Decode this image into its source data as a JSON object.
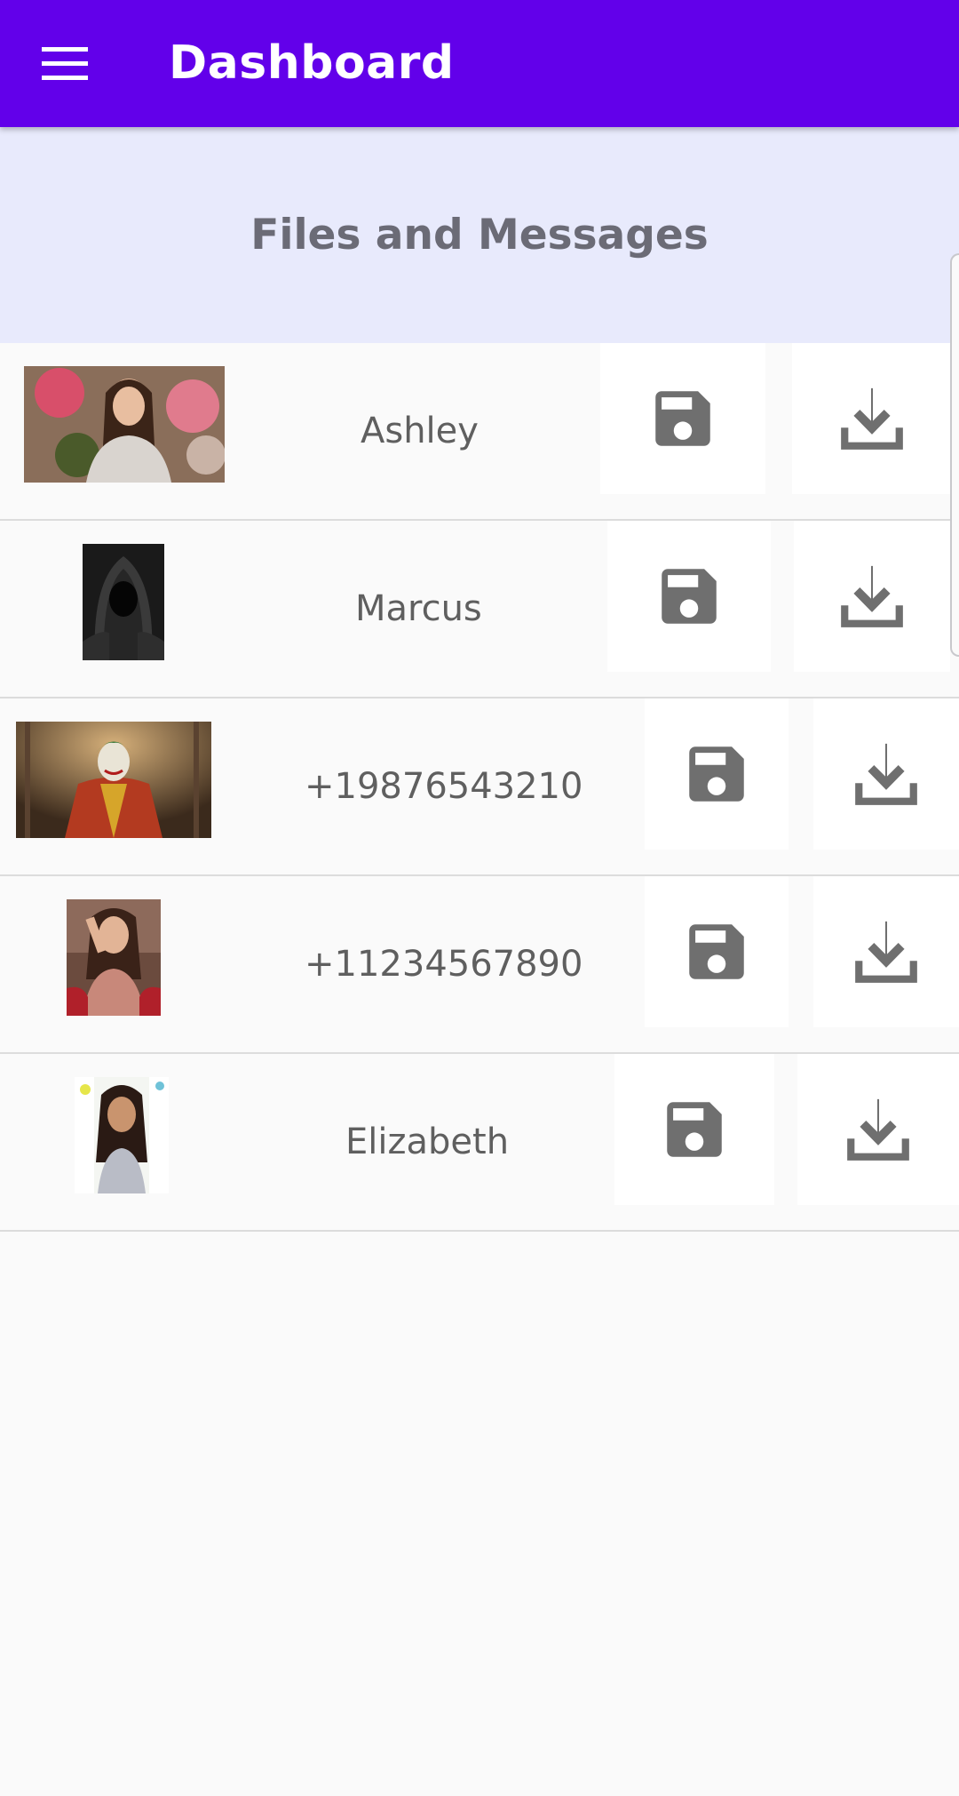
{
  "app_bar": {
    "title": "Dashboard",
    "menu_icon": "menu-icon",
    "color": "#6200ea"
  },
  "section": {
    "title": "Files and Messages",
    "background": "#e8eafc"
  },
  "contacts": [
    {
      "name": "Ashley",
      "save_icon": "save-icon",
      "download_icon": "download-icon"
    },
    {
      "name": "Marcus",
      "save_icon": "save-icon",
      "download_icon": "download-icon"
    },
    {
      "name": "+19876543210",
      "save_icon": "save-icon",
      "download_icon": "download-icon"
    },
    {
      "name": "+11234567890",
      "save_icon": "save-icon",
      "download_icon": "download-icon"
    },
    {
      "name": "Elizabeth",
      "save_icon": "save-icon",
      "download_icon": "download-icon"
    }
  ],
  "icon_color": "#6f6f6f"
}
